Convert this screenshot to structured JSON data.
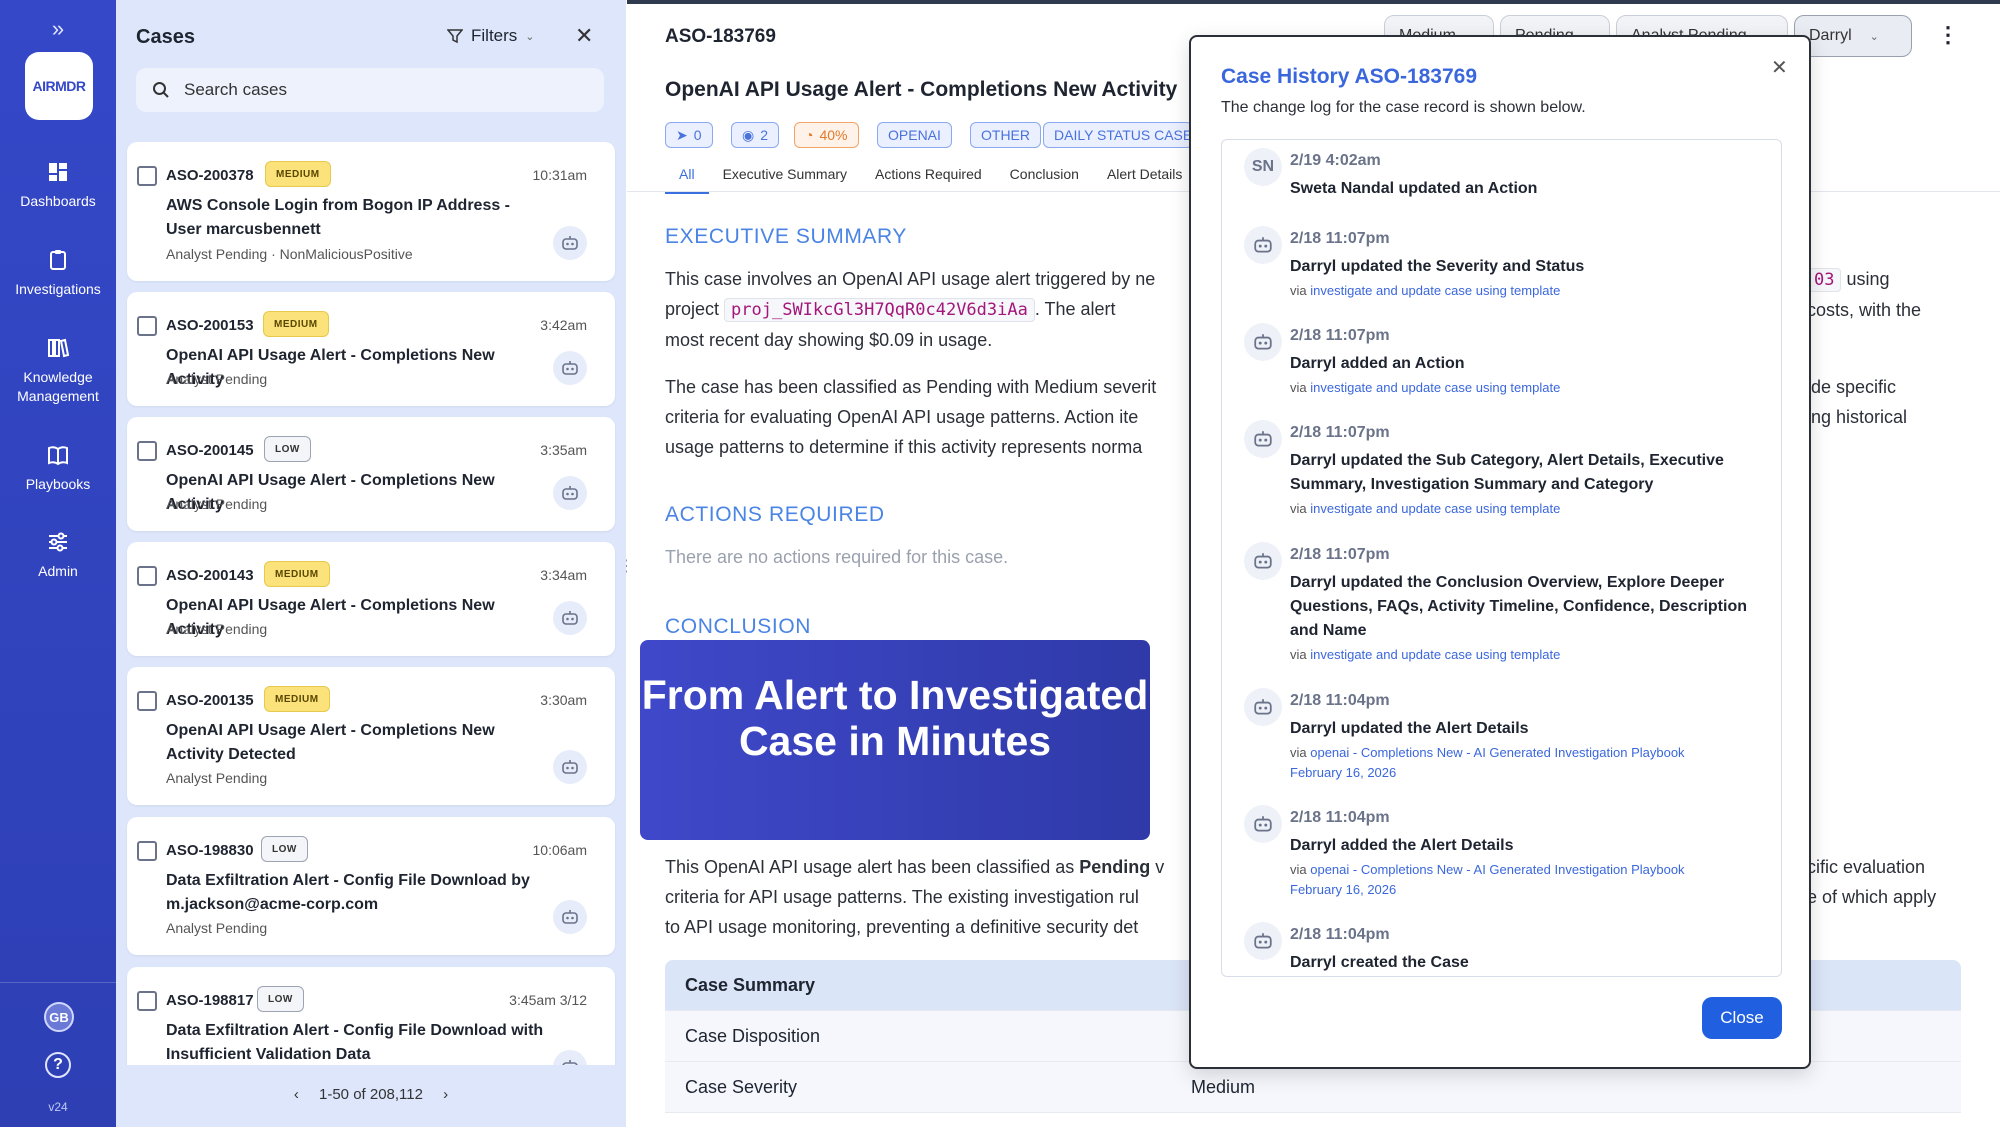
{
  "nav": {
    "expand_icon": "double-chevron-right-icon",
    "logo_text": "AIRMDR",
    "items": [
      {
        "label": "Dashboards",
        "icon": "dashboard-icon"
      },
      {
        "label": "Investigations",
        "icon": "clipboard-icon"
      },
      {
        "label": "Knowledge Management",
        "icon": "library-icon"
      },
      {
        "label": "Playbooks",
        "icon": "book-icon"
      },
      {
        "label": "Admin",
        "icon": "sliders-icon"
      }
    ],
    "avatar": "GB",
    "help": "?",
    "version": "v24"
  },
  "list": {
    "title": "Cases",
    "filters_label": "Filters",
    "search_placeholder": "Search cases",
    "pagination": "1-50 of 208,112",
    "cards": [
      {
        "id": "ASO-200378",
        "severity": "MEDIUM",
        "time": "10:31am",
        "title": "AWS Console Login from Bogon IP Address - User marcusbennett",
        "status": "Analyst Pending  ·  NonMaliciousPositive"
      },
      {
        "id": "ASO-200153",
        "severity": "MEDIUM",
        "time": "3:42am",
        "title": "OpenAI API Usage Alert - Completions New Activity",
        "status": "Analyst Pending"
      },
      {
        "id": "ASO-200145",
        "severity": "LOW",
        "time": "3:35am",
        "title": "OpenAI API Usage Alert - Completions New Activity",
        "status": "Analyst Pending"
      },
      {
        "id": "ASO-200143",
        "severity": "MEDIUM",
        "time": "3:34am",
        "title": "OpenAI API Usage Alert - Completions New Activity",
        "status": "Analyst Pending"
      },
      {
        "id": "ASO-200135",
        "severity": "MEDIUM",
        "time": "3:30am",
        "title": "OpenAI API Usage Alert - Completions New Activity Detected",
        "status": "Analyst Pending"
      },
      {
        "id": "ASO-198830",
        "severity": "LOW",
        "time": "10:06am",
        "title": "Data Exfiltration Alert - Config File Download by m.jackson@acme-corp.com",
        "status": "Analyst Pending"
      },
      {
        "id": "ASO-198817",
        "severity": "LOW",
        "time": "3:45am 3/12",
        "title": "Data Exfiltration Alert - Config File Download with Insufficient Validation Data",
        "status": ""
      }
    ]
  },
  "main": {
    "case_id": "ASO-183769",
    "header_pills": [
      "Medium",
      "Pending",
      "Analyst Pending",
      "Darryl"
    ],
    "title": "OpenAI API Usage Alert - Completions New Activity",
    "tags": [
      {
        "label": "0",
        "icon": "send-icon"
      },
      {
        "label": "2",
        "icon": "eye-icon"
      },
      {
        "label": "40%",
        "icon": "gauge-icon"
      },
      {
        "label": "OPENAI"
      },
      {
        "label": "OTHER"
      },
      {
        "label": "DAILY STATUS CASE"
      }
    ],
    "tabs": [
      "All",
      "Executive Summary",
      "Actions Required",
      "Conclusion",
      "Alert Details"
    ],
    "exec_heading": "EXECUTIVE SUMMARY",
    "exec_p1_a": "This case involves an OpenAI API usage alert triggered by ne",
    "exec_p1_code_right": "03",
    "exec_p1_b": " using",
    "exec_p1_c": "project ",
    "exec_p1_code": "proj_SWIkcGl3H7QqR0c42V6d3iAa",
    "exec_p1_d": ". The alert",
    "exec_p1_e": "costs, with the",
    "exec_p1_f": "most recent day showing $0.09 in usage.",
    "exec_p2_a": "The case has been classified as Pending with Medium severit",
    "exec_p2_b": "ide specific",
    "exec_p2_c": "criteria for evaluating OpenAI API usage patterns. Action ite",
    "exec_p2_d": "ing historical",
    "exec_p2_e": "usage patterns to determine if this activity represents norma",
    "actions_heading": "ACTIONS REQUIRED",
    "actions_text": "There are no actions required for this case.",
    "conclusion_heading": "CONCLUSION",
    "overlay_text": "From Alert to Investigated Case in Minutes",
    "concl_p_a": "This OpenAI API usage alert has been classified as ",
    "concl_p_bold": "Pending",
    "concl_p_b": " v",
    "concl_p_c": "cific evaluation",
    "concl_p_d": "criteria for API usage patterns. The existing investigation rul",
    "concl_p_e": "e of which apply",
    "concl_p_f": "to API usage monitoring, preventing a definitive security det",
    "summary": {
      "heading": "Case Summary",
      "rows": [
        {
          "label": "Case Disposition",
          "value": ""
        },
        {
          "label": "Case Severity",
          "value": "Medium"
        }
      ]
    }
  },
  "modal": {
    "title": "Case History ASO-183769",
    "description": "The change log for the case record is shown below.",
    "close_label": "Close",
    "entries": [
      {
        "avatar": "SN",
        "time": "2/19 4:02am",
        "text": "Sweta Nandal updated an Action",
        "via_prefix": "",
        "via": "",
        "via_extra": ""
      },
      {
        "avatar": "bot",
        "time": "2/18 11:07pm",
        "text": "Darryl updated the Severity and Status",
        "via_prefix": "via ",
        "via": "investigate and update case using template",
        "via_extra": ""
      },
      {
        "avatar": "bot",
        "time": "2/18 11:07pm",
        "text": "Darryl added an Action",
        "via_prefix": "via ",
        "via": "investigate and update case using template",
        "via_extra": ""
      },
      {
        "avatar": "bot",
        "time": "2/18 11:07pm",
        "text": "Darryl updated the Sub Category, Alert Details, Executive Summary, Investigation Summary and Category",
        "via_prefix": "via ",
        "via": "investigate and update case using template",
        "via_extra": ""
      },
      {
        "avatar": "bot",
        "time": "2/18 11:07pm",
        "text": "Darryl updated the Conclusion Overview, Explore Deeper Questions, FAQs, Activity Timeline, Confidence, Description and Name",
        "via_prefix": "via ",
        "via": "investigate and update case using template",
        "via_extra": ""
      },
      {
        "avatar": "bot",
        "time": "2/18 11:04pm",
        "text": "Darryl updated the Alert Details",
        "via_prefix": "via ",
        "via": "openai - Completions New - AI Generated Investigation Playbook",
        "via_extra": "February 16, 2026"
      },
      {
        "avatar": "bot",
        "time": "2/18 11:04pm",
        "text": "Darryl added the Alert Details",
        "via_prefix": "via ",
        "via": "openai - Completions New - AI Generated Investigation Playbook",
        "via_extra": "February 16, 2026"
      },
      {
        "avatar": "bot",
        "time": "2/18 11:04pm",
        "text": "Darryl created the Case",
        "via_prefix": "",
        "via": "",
        "via_extra": ""
      }
    ]
  },
  "colors": {
    "nav_bg": "#3448c8",
    "list_bg": "#dde6fb",
    "accent": "#3a67dc",
    "medium_badge": "#fbe27a",
    "close_button": "#1f5fe0"
  }
}
